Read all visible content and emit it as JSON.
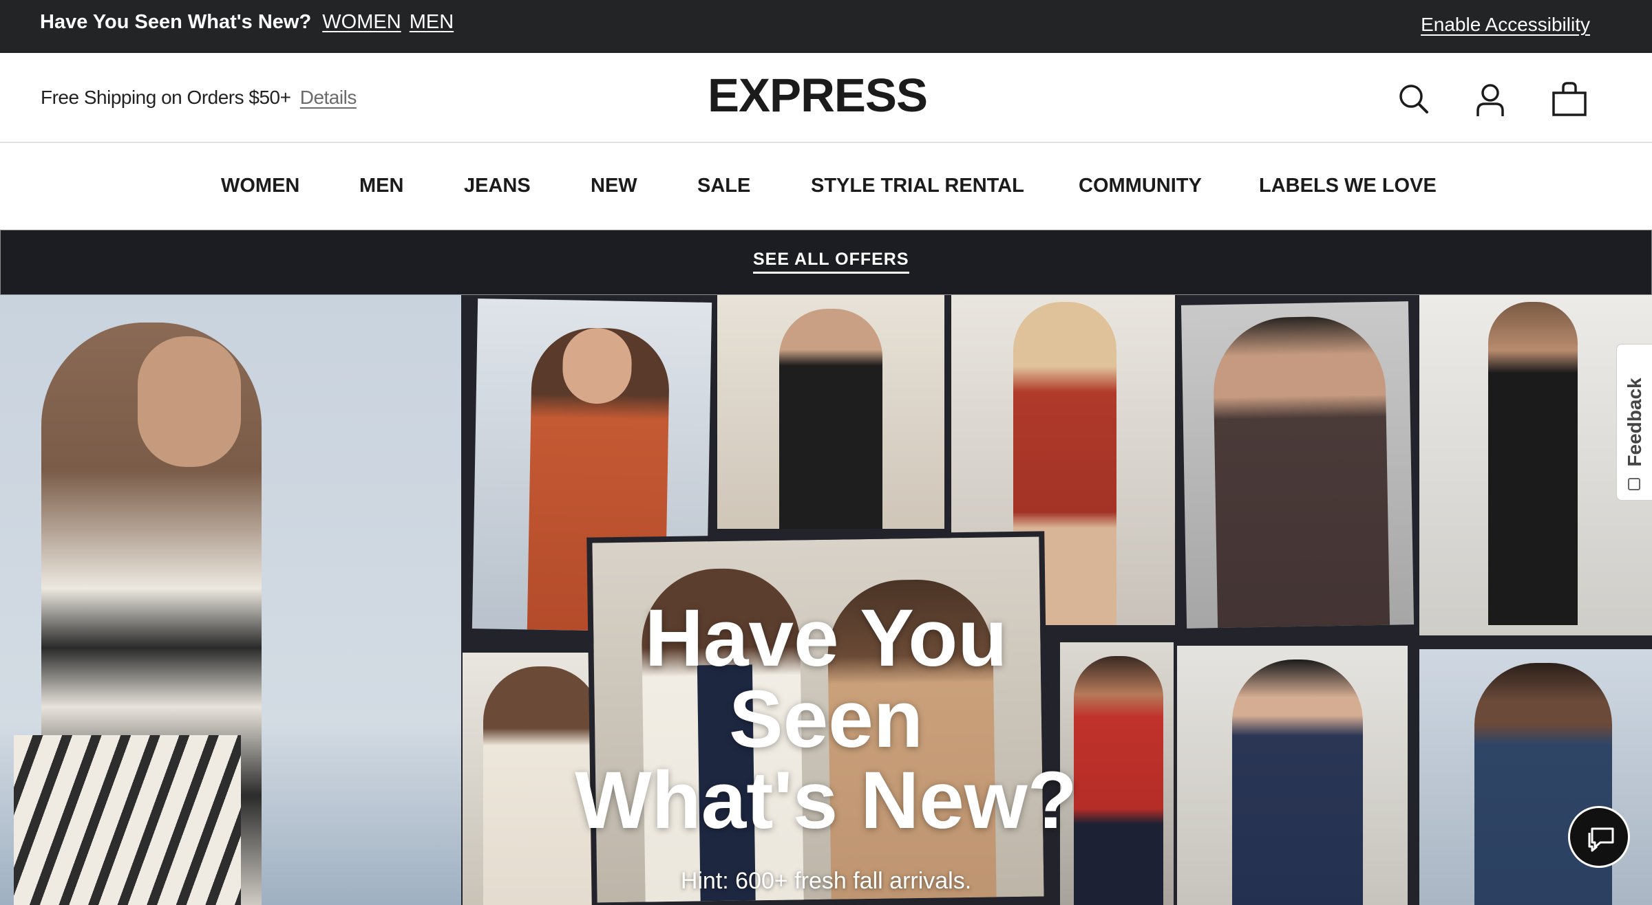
{
  "promo": {
    "headline": "Have You Seen What's New?",
    "links": [
      "WOMEN",
      "MEN"
    ],
    "accessibility": "Enable Accessibility"
  },
  "header": {
    "shipping_text": "Free Shipping on Orders $50+",
    "details_link": "Details",
    "logo": "EXPRESS",
    "icons": [
      "search-icon",
      "account-icon",
      "shopping-bag-icon"
    ]
  },
  "nav": {
    "items": [
      "WOMEN",
      "MEN",
      "JEANS",
      "NEW",
      "SALE",
      "STYLE TRIAL RENTAL",
      "COMMUNITY",
      "LABELS WE LOVE"
    ]
  },
  "offers": {
    "label": "SEE ALL OFFERS"
  },
  "hero": {
    "title_lines": [
      "Have You",
      "Seen",
      "What's New?"
    ],
    "subtitle": "Hint: 600+ fresh fall arrivals."
  },
  "feedback": {
    "label": "Feedback"
  },
  "chat": {
    "icon": "chat-bubbles-icon"
  }
}
